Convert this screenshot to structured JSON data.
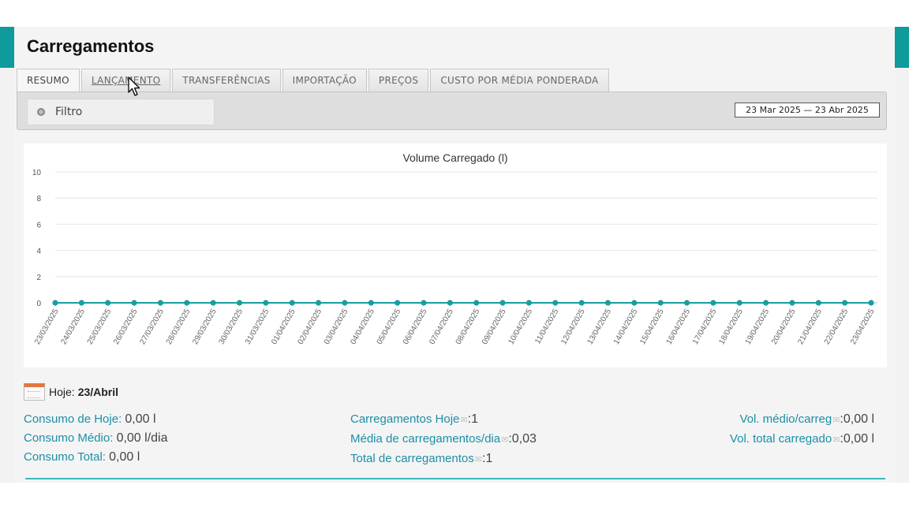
{
  "page": {
    "title": "Carregamentos"
  },
  "tabs": [
    {
      "label": "RESUMO",
      "active": true
    },
    {
      "label": "LANÇAMENTO",
      "active": false
    },
    {
      "label": "TRANSFERÊNCIAS",
      "active": false
    },
    {
      "label": "IMPORTAÇÃO",
      "active": false
    },
    {
      "label": "PREÇOS",
      "active": false
    },
    {
      "label": "CUSTO POR MÉDIA PONDERADA",
      "active": false
    }
  ],
  "filter": {
    "label": "Filtro",
    "date_range": "23 Mar 2025 — 23 Abr 2025"
  },
  "chart_data": {
    "type": "line",
    "title": "Volume Carregado (l)",
    "xlabel": "",
    "ylabel": "",
    "ylim": [
      0,
      10
    ],
    "yticks": [
      0,
      2,
      4,
      6,
      8,
      10
    ],
    "grid": true,
    "color": "#1a9da1",
    "categories": [
      "23/03/2025",
      "24/03/2025",
      "25/03/2025",
      "26/03/2025",
      "27/03/2025",
      "28/03/2025",
      "29/03/2025",
      "30/03/2025",
      "31/03/2025",
      "01/04/2025",
      "02/04/2025",
      "03/04/2025",
      "04/04/2025",
      "05/04/2025",
      "06/04/2025",
      "07/04/2025",
      "08/04/2025",
      "09/04/2025",
      "10/04/2025",
      "11/04/2025",
      "12/04/2025",
      "13/04/2025",
      "14/04/2025",
      "15/04/2025",
      "16/04/2025",
      "17/04/2025",
      "18/04/2025",
      "19/04/2025",
      "20/04/2025",
      "21/04/2025",
      "22/04/2025",
      "23/04/2025"
    ],
    "series": [
      {
        "values": [
          0,
          0,
          0,
          0,
          0,
          0,
          0,
          0,
          0,
          0,
          0,
          0,
          0,
          0,
          0,
          0,
          0,
          0,
          0,
          0,
          0,
          0,
          0,
          0,
          0,
          0,
          0,
          0,
          0,
          0,
          0,
          0
        ]
      }
    ]
  },
  "today": {
    "label": "Hoje:",
    "value": "23/Abril"
  },
  "stats": {
    "col1": [
      {
        "label": "Consumo de Hoje:",
        "value": "0,00 l"
      },
      {
        "label": "Consumo Médio:",
        "value": "0,00 l/dia"
      },
      {
        "label": "Consumo Total:",
        "value": "0,00 l"
      }
    ],
    "col2": [
      {
        "label": "Carregamentos Hoje",
        "value": "1"
      },
      {
        "label": "Média de carregamentos/dia",
        "value": "0,03"
      },
      {
        "label": "Total de carregamentos",
        "value": "1"
      }
    ],
    "col3": [
      {
        "label": "Vol. médio/carreg",
        "value": "0,00 l"
      },
      {
        "label": "Vol. total carregado",
        "value": "0,00 l"
      }
    ]
  },
  "colors": {
    "accent": "#0f9a9c",
    "link": "#1c8fa6",
    "line": "#1a9da1"
  },
  "icons": {
    "filter": "radio-dot-icon",
    "today": "calendar-icon",
    "stat_glyph": "envelope-icon",
    "pointer": "mouse-cursor-icon"
  }
}
